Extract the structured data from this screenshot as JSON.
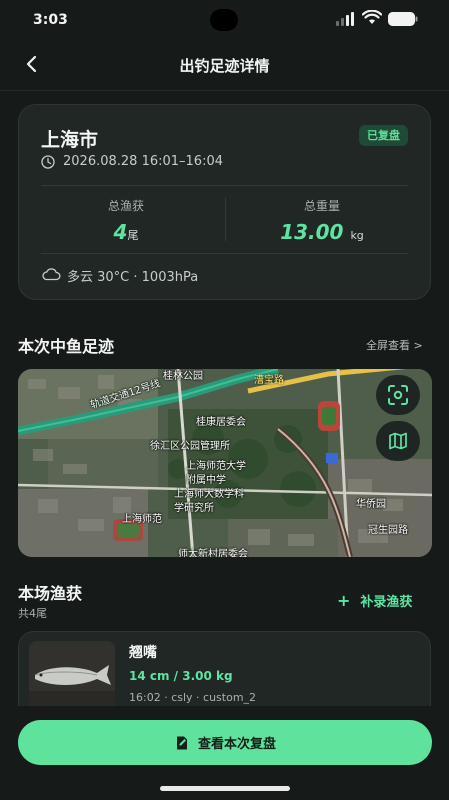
{
  "status_bar": {
    "time": "3:03"
  },
  "header": {
    "title": "出钓足迹详情"
  },
  "summary": {
    "city": "上海市",
    "badge": "已复盘",
    "date_range": "2026.08.28 16:01–16:04",
    "total_catch_label": "总渔获",
    "total_catch_value": "4",
    "total_catch_unit": "尾",
    "total_weight_label": "总重量",
    "total_weight_value": "13.00",
    "total_weight_unit": "kg",
    "weather": "多云 30°C · 1003hPa"
  },
  "trail_section": {
    "title": "本次中鱼足迹",
    "fullscreen_link": "全屏查看 >",
    "map_labels": {
      "park": "桂林公园",
      "road_caobao": "漕宝路",
      "metro": "轨道交通12号线",
      "committee": "桂康居委会",
      "xuhui_park": "徐汇区公园管理所",
      "shnu": "上海师范大学",
      "affiliated": "附属中学",
      "shnu_math": "上海师大数学科",
      "research": "学研究所",
      "shnu_short": "上海师范",
      "xingsheng": "冠生园路",
      "huawen": "华侨园",
      "residents": "师大新村居委会"
    }
  },
  "catch_section": {
    "title": "本场渔获",
    "count": "共4尾",
    "add_button": "补录渔获",
    "items": [
      {
        "name": "翘嘴",
        "measure": "14 cm / 3.00 kg",
        "meta": "16:02 · csly · custom_2"
      }
    ]
  },
  "cta": {
    "label": "查看本次复盘"
  },
  "colors": {
    "background": "#161b1a",
    "card": "#202725",
    "accent": "#5fe3a1",
    "badge_bg": "#1f4a36"
  }
}
